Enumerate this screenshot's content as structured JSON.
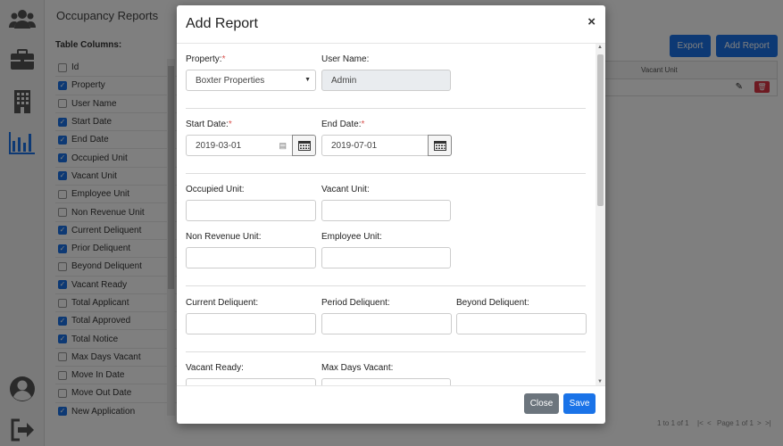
{
  "app": {
    "page_title": "Occupancy Reports",
    "table_columns_label": "Table Columns:",
    "export_label": "Export",
    "add_report_label": "Add Report",
    "grid_header_vacant": "Vacant Unit",
    "pager_count": "1 to 1 of 1",
    "pager_page": "Page 1 of 1",
    "columns": [
      {
        "label": "Id",
        "checked": false
      },
      {
        "label": "Property",
        "checked": true
      },
      {
        "label": "User Name",
        "checked": false
      },
      {
        "label": "Start Date",
        "checked": true
      },
      {
        "label": "End Date",
        "checked": true
      },
      {
        "label": "Occupied Unit",
        "checked": true
      },
      {
        "label": "Vacant Unit",
        "checked": true
      },
      {
        "label": "Employee Unit",
        "checked": false
      },
      {
        "label": "Non Revenue Unit",
        "checked": false
      },
      {
        "label": "Current Deliquent",
        "checked": true
      },
      {
        "label": "Prior Deliquent",
        "checked": true
      },
      {
        "label": "Beyond Deliquent",
        "checked": false
      },
      {
        "label": "Vacant Ready",
        "checked": true
      },
      {
        "label": "Total Applicant",
        "checked": false
      },
      {
        "label": "Total Approved",
        "checked": true
      },
      {
        "label": "Total Notice",
        "checked": true
      },
      {
        "label": "Max Days Vacant",
        "checked": false
      },
      {
        "label": "Move In Date",
        "checked": false
      },
      {
        "label": "Move Out Date",
        "checked": false
      },
      {
        "label": "New Application",
        "checked": true
      }
    ],
    "sidebar_icons": [
      "users-icon",
      "briefcase-icon",
      "building-icon",
      "bar-chart-icon",
      "user-avatar-icon",
      "logout-icon"
    ]
  },
  "modal": {
    "title": "Add Report",
    "close_symbol": "×",
    "property_label": "Property:",
    "property_value": "Boxter Properties",
    "username_label": "User Name:",
    "username_value": "Admin",
    "start_date_label": "Start Date:",
    "start_date_value": "2019-03-01",
    "end_date_label": "End Date:",
    "end_date_value": "2019-07-01",
    "occupied_label": "Occupied Unit:",
    "vacant_label": "Vacant Unit:",
    "nonrevenue_label": "Non Revenue Unit:",
    "employee_label": "Employee Unit:",
    "current_del_label": "Current Deliquent:",
    "period_del_label": "Period Deliquent:",
    "beyond_del_label": "Beyond Deliquent:",
    "vacant_ready_label": "Vacant Ready:",
    "max_days_label": "Max Days Vacant:",
    "required_mark": "*",
    "close_button": "Close",
    "save_button": "Save"
  },
  "colors": {
    "primary": "#1a73e8",
    "secondary": "#6c757d",
    "danger": "#dc3545",
    "required": "#d9534f"
  }
}
